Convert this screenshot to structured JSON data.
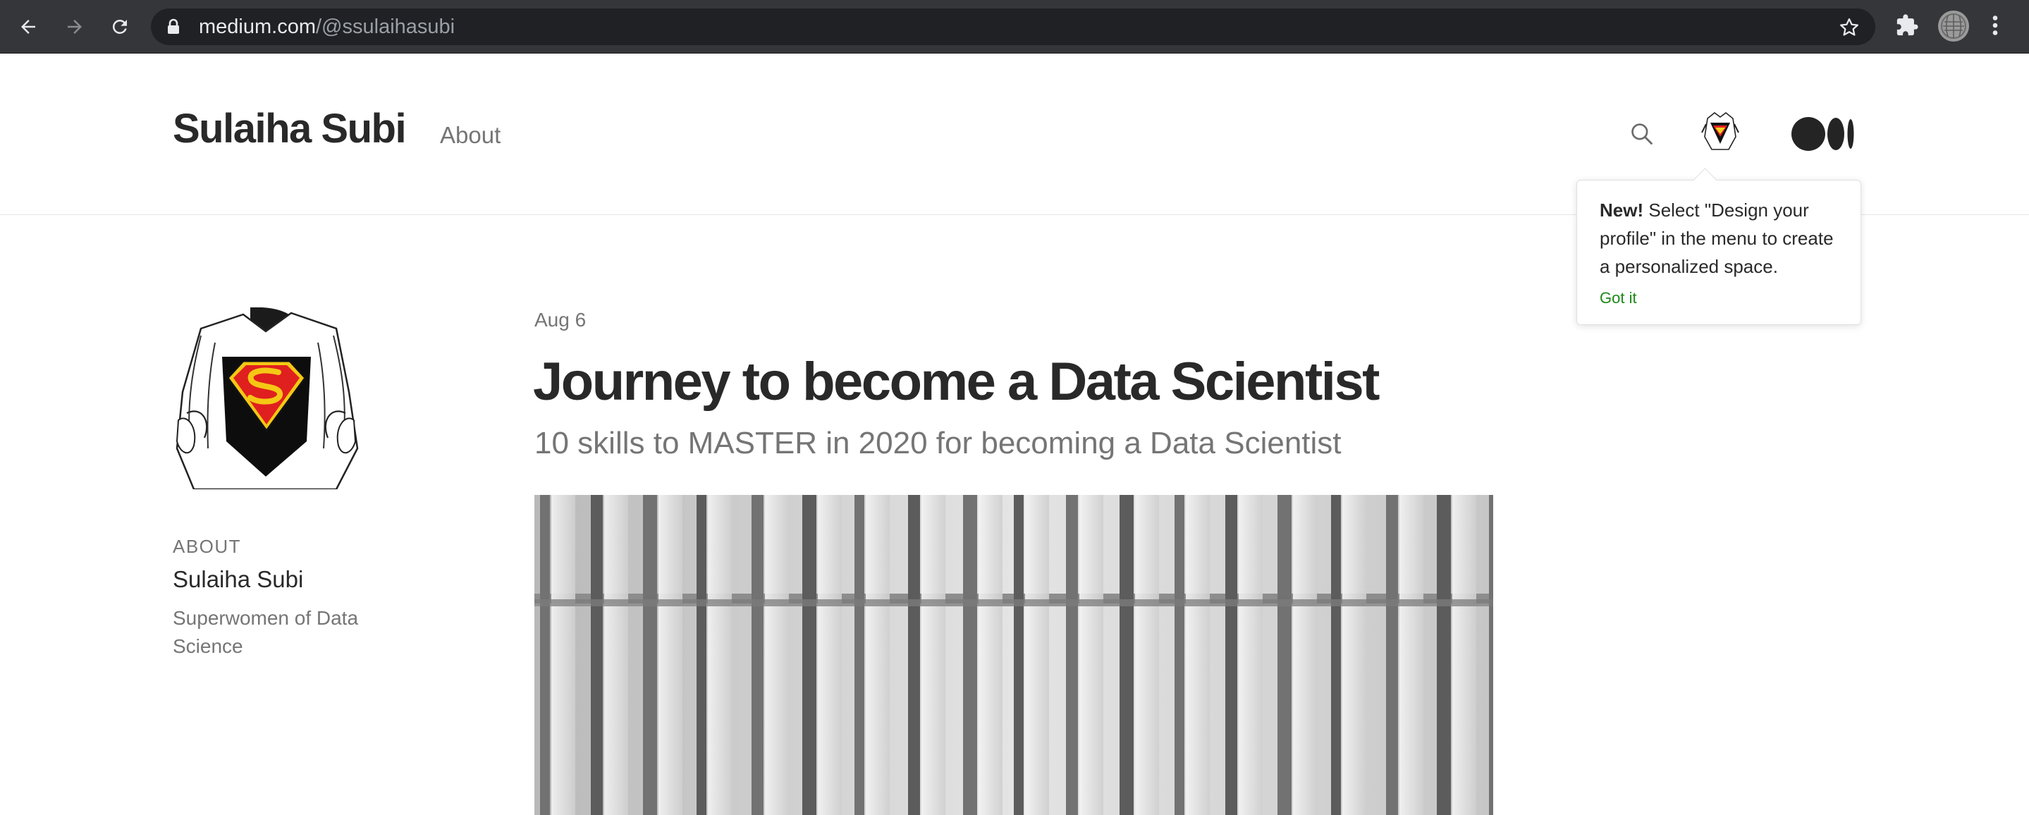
{
  "browser": {
    "url_domain": "medium.com",
    "url_path": "/@ssulaihasubi",
    "back_icon": "back-arrow-icon",
    "forward_icon": "forward-arrow-icon",
    "reload_icon": "reload-icon",
    "lock_icon": "lock-icon",
    "star_icon": "star-icon",
    "extensions_icon": "puzzle-icon",
    "menu_icon": "kebab-menu-icon"
  },
  "header": {
    "publication_name": "Sulaiha Subi",
    "nav_about": "About",
    "search_icon": "search-icon",
    "logo": "medium-logo"
  },
  "tooltip": {
    "bold_prefix": "New!",
    "message": " Select \"Design your profile\" in the menu to create a personalized space.",
    "action": "Got it",
    "action_color": "#1a8917"
  },
  "sidebar": {
    "about_heading": "ABOUT",
    "author_name": "Sulaiha Subi",
    "bio": "Superwomen of Data Science"
  },
  "post": {
    "date": "Aug 6",
    "title": "Journey to become a Data Scientist",
    "subtitle": "10 skills to MASTER in 2020 for becoming a Data Scientist"
  },
  "colors": {
    "chrome_bg": "#35363a",
    "omnibox_bg": "#202124",
    "text_primary": "#292929",
    "text_secondary": "#757575",
    "accent_green": "#1a8917"
  }
}
